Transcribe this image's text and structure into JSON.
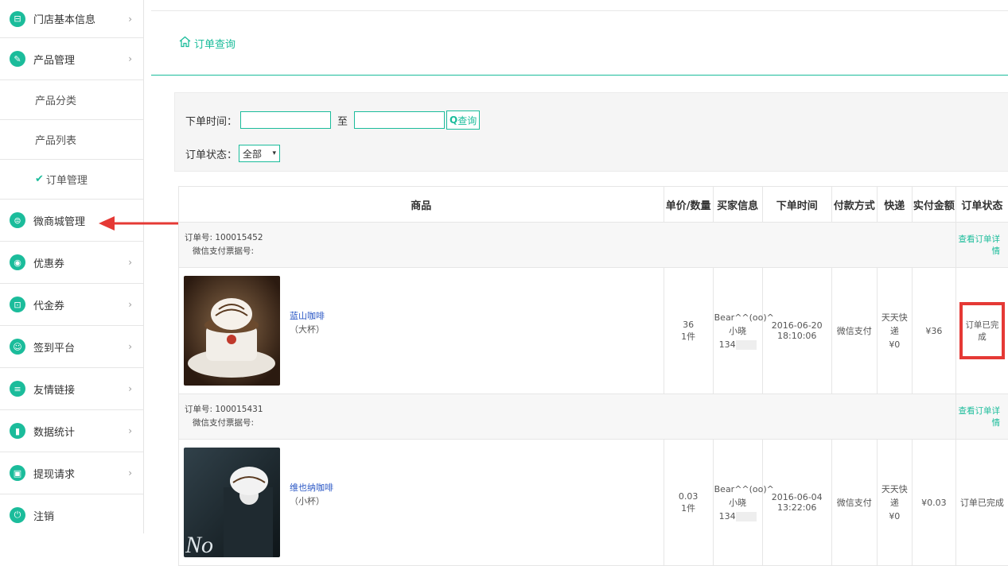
{
  "sidebar": {
    "items": [
      {
        "label": "门店基本信息",
        "icon": "doc-icon",
        "glyph": "⊟",
        "arrow": "›"
      },
      {
        "label": "产品管理",
        "icon": "tag-icon",
        "glyph": "✎",
        "arrow": "›"
      }
    ],
    "sub_items": [
      {
        "label": "产品分类"
      },
      {
        "label": "产品列表"
      },
      {
        "label": "订单管理",
        "active": true
      }
    ],
    "items2": [
      {
        "label": "微商城管理",
        "icon": "shop-icon",
        "glyph": "⊜",
        "arrow": ""
      },
      {
        "label": "优惠券",
        "icon": "coupon-icon",
        "glyph": "◉",
        "arrow": "›"
      },
      {
        "label": "代金券",
        "icon": "voucher-icon",
        "glyph": "⊡",
        "arrow": "›"
      },
      {
        "label": "签到平台",
        "icon": "signin-icon",
        "glyph": "☺",
        "arrow": "›"
      },
      {
        "label": "友情链接",
        "icon": "link-icon",
        "glyph": "≡",
        "arrow": "›"
      },
      {
        "label": "数据统计",
        "icon": "stats-icon",
        "glyph": "▮",
        "arrow": "›"
      },
      {
        "label": "提现请求",
        "icon": "wallet-icon",
        "glyph": "▣",
        "arrow": "›"
      },
      {
        "label": "注销",
        "icon": "power-icon",
        "glyph": "⏻",
        "arrow": ""
      }
    ]
  },
  "page": {
    "title": "订单查询"
  },
  "filter": {
    "time_label": "下单时间：",
    "to_label": "至",
    "search_label": "查询",
    "status_label": "订单状态：",
    "status_value": "全部",
    "select_arrow": "▾"
  },
  "table": {
    "headers": [
      "商品",
      "单价/数量",
      "买家信息",
      "下单时间",
      "付款方式",
      "快递",
      "实付金额",
      "订单状态"
    ],
    "detail_link": "查看订单详情",
    "orders": [
      {
        "order_no": "订单号: 100015452",
        "wx_no": "微信支付票据号:",
        "product": "蓝山咖啡",
        "spec": "（大杯）",
        "price": "36",
        "qty": "1件",
        "buyer1": "Bear^^(oo)^",
        "buyer2": "小晓",
        "buyer3": "134",
        "time": "2016-06-20 18:10:06",
        "pay": "微信支付",
        "ship1": "天天快",
        "ship2": "递",
        "ship3": "¥0",
        "amount": "¥36",
        "status": "订单已完成"
      },
      {
        "order_no": "订单号: 100015431",
        "wx_no": "微信支付票据号:",
        "product": "维也纳咖啡",
        "spec": "（小杯）",
        "price": "0.03",
        "qty": "1件",
        "buyer1": "Bear^^(oo)^",
        "buyer2": "小晓",
        "buyer3": "134",
        "time": "2016-06-04 13:22:06",
        "pay": "微信支付",
        "ship1": "天天快",
        "ship2": "递",
        "ship3": "¥0",
        "amount": "¥0.03",
        "status": "订单已完成"
      }
    ]
  },
  "colors": {
    "accent": "#1bbc9b",
    "highlight": "#e53935",
    "link": "#2a57c5"
  }
}
